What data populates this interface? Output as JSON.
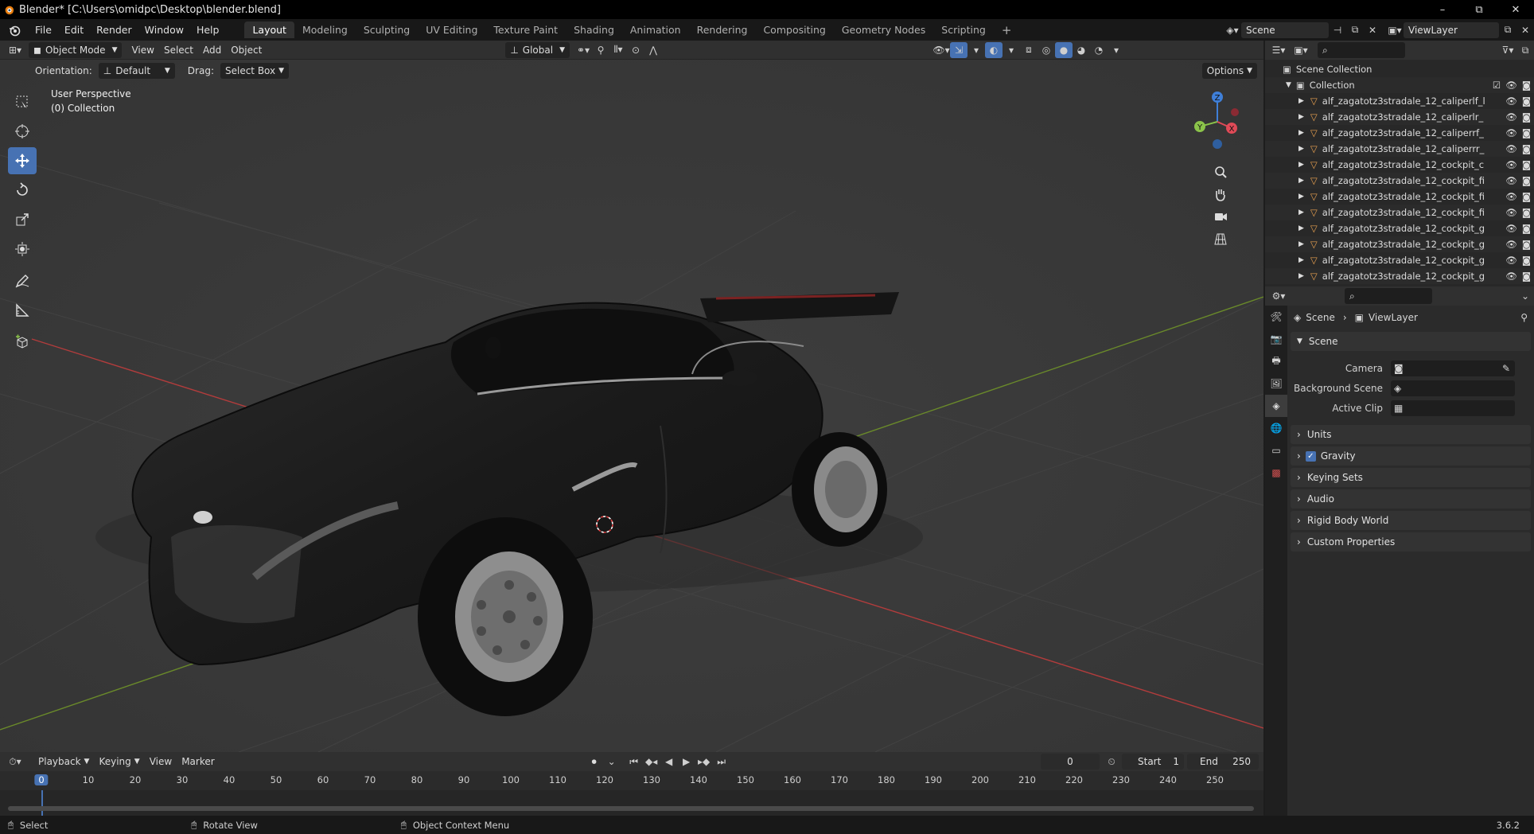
{
  "window": {
    "title": "Blender* [C:\\Users\\omidpc\\Desktop\\blender.blend]",
    "buttons": [
      "–",
      "⧉",
      "✕"
    ]
  },
  "topbar": {
    "menu": [
      "File",
      "Edit",
      "Render",
      "Window",
      "Help"
    ],
    "workspaces": [
      "Layout",
      "Modeling",
      "Sculpting",
      "UV Editing",
      "Texture Paint",
      "Shading",
      "Animation",
      "Rendering",
      "Compositing",
      "Geometry Nodes",
      "Scripting"
    ],
    "active_workspace": "Layout",
    "add_workspace": "+",
    "scene": "Scene",
    "view_layer": "ViewLayer"
  },
  "viewport_header": {
    "mode": "Object Mode",
    "menus": [
      "View",
      "Select",
      "Add",
      "Object"
    ],
    "transform_orientation": "Global",
    "orientation_label": "Orientation:",
    "orientation_value": "Default",
    "drag_label": "Drag:",
    "drag_value": "Select Box",
    "options": "Options"
  },
  "viewport": {
    "perspective": "User Perspective",
    "collection": "(0) Collection",
    "gizmo_axes": [
      "Z",
      "Y",
      "X"
    ]
  },
  "outliner": {
    "root": "Scene Collection",
    "collection": "Collection",
    "items": [
      "alf_zagatotz3stradale_12_caliperlf_l",
      "alf_zagatotz3stradale_12_caliperlr_",
      "alf_zagatotz3stradale_12_caliperrf_",
      "alf_zagatotz3stradale_12_caliperrr_",
      "alf_zagatotz3stradale_12_cockpit_c",
      "alf_zagatotz3stradale_12_cockpit_fi",
      "alf_zagatotz3stradale_12_cockpit_fi",
      "alf_zagatotz3stradale_12_cockpit_fi",
      "alf_zagatotz3stradale_12_cockpit_g",
      "alf_zagatotz3stradale_12_cockpit_g",
      "alf_zagatotz3stradale_12_cockpit_g",
      "alf_zagatotz3stradale_12_cockpit_g"
    ]
  },
  "properties": {
    "breadcrumb": [
      "Scene",
      "ViewLayer"
    ],
    "panel": "Scene",
    "fields": [
      {
        "label": "Camera",
        "value": ""
      },
      {
        "label": "Background Scene",
        "value": ""
      },
      {
        "label": "Active Clip",
        "value": ""
      }
    ],
    "subpanels": [
      "Units",
      "Gravity",
      "Keying Sets",
      "Audio",
      "Rigid Body World",
      "Custom Properties"
    ],
    "gravity_checked": true
  },
  "timeline": {
    "menus": [
      "Playback",
      "Keying",
      "View",
      "Marker"
    ],
    "current_frame": "0",
    "start_label": "Start",
    "start": "1",
    "end_label": "End",
    "end": "250",
    "ruler": [
      "0",
      "10",
      "20",
      "30",
      "40",
      "50",
      "60",
      "70",
      "80",
      "90",
      "100",
      "110",
      "120",
      "130",
      "140",
      "150",
      "160",
      "170",
      "180",
      "190",
      "200",
      "210",
      "220",
      "230",
      "240",
      "250"
    ]
  },
  "statusbar": {
    "select": "Select",
    "rotate": "Rotate View",
    "context": "Object Context Menu",
    "version": "3.6.2"
  },
  "colors": {
    "accent": "#4772b3",
    "axis_x": "#b23c3c",
    "axis_y": "#6a8a2a",
    "gizmo_x": "#e04a57",
    "gizmo_y": "#8bc34a",
    "gizmo_z": "#3f7fd8"
  }
}
